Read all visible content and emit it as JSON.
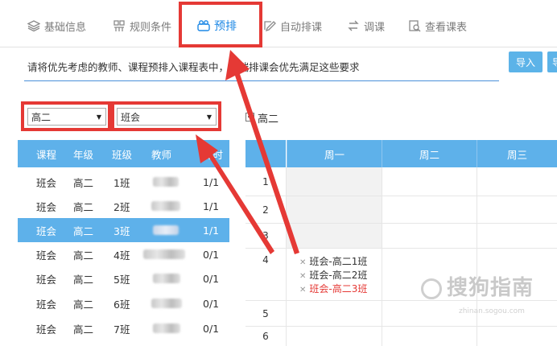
{
  "nav": {
    "items": [
      {
        "label": "基础信息",
        "icon": "layers-icon"
      },
      {
        "label": "规则条件",
        "icon": "rules-icon"
      },
      {
        "label": "预排",
        "icon": "people-icon"
      },
      {
        "label": "自动排课",
        "icon": "edit-icon"
      },
      {
        "label": "调课",
        "icon": "swap-icon"
      },
      {
        "label": "查看课表",
        "icon": "view-schedule-icon"
      }
    ],
    "active_index": 2,
    "accent_color": "#1e88e5"
  },
  "description": "请将优先考虑的教师、课程预排入课程表中，云端排课会优先满足这些要求",
  "buttons": {
    "import_label": "导入",
    "second_label": "导"
  },
  "filters": {
    "grade_value": "高二",
    "course_value": "班会"
  },
  "grade_checkbox": {
    "label": "高二",
    "checked": true
  },
  "course_list": {
    "headers": [
      "课程",
      "年级",
      "班级",
      "教师",
      "课时"
    ],
    "rows": [
      {
        "course": "班会",
        "grade": "高二",
        "class": "1班",
        "hours": "1/1",
        "selected": false
      },
      {
        "course": "班会",
        "grade": "高二",
        "class": "2班",
        "hours": "1/1",
        "selected": false
      },
      {
        "course": "班会",
        "grade": "高二",
        "class": "3班",
        "hours": "1/1",
        "selected": true
      },
      {
        "course": "班会",
        "grade": "高二",
        "class": "4班",
        "hours": "0/1",
        "selected": false
      },
      {
        "course": "班会",
        "grade": "高二",
        "class": "5班",
        "hours": "0/1",
        "selected": false
      },
      {
        "course": "班会",
        "grade": "高二",
        "class": "6班",
        "hours": "0/1",
        "selected": false
      },
      {
        "course": "班会",
        "grade": "高二",
        "class": "7班",
        "hours": "0/1",
        "selected": false
      }
    ],
    "header_color": "#5eb1ea"
  },
  "timetable": {
    "days": [
      "周一",
      "周二",
      "周三"
    ],
    "periods": [
      "1",
      "2",
      "3",
      "4",
      "5",
      "6"
    ],
    "entries": [
      {
        "text": "班会-高二1班",
        "highlight": false
      },
      {
        "text": "班会-高二2班",
        "highlight": false
      },
      {
        "text": "班会-高二3班",
        "highlight": true
      }
    ],
    "highlight_color": "#e53935"
  },
  "watermark": {
    "text": "搜狗指南",
    "sub": "zhinan.sogou.com"
  }
}
